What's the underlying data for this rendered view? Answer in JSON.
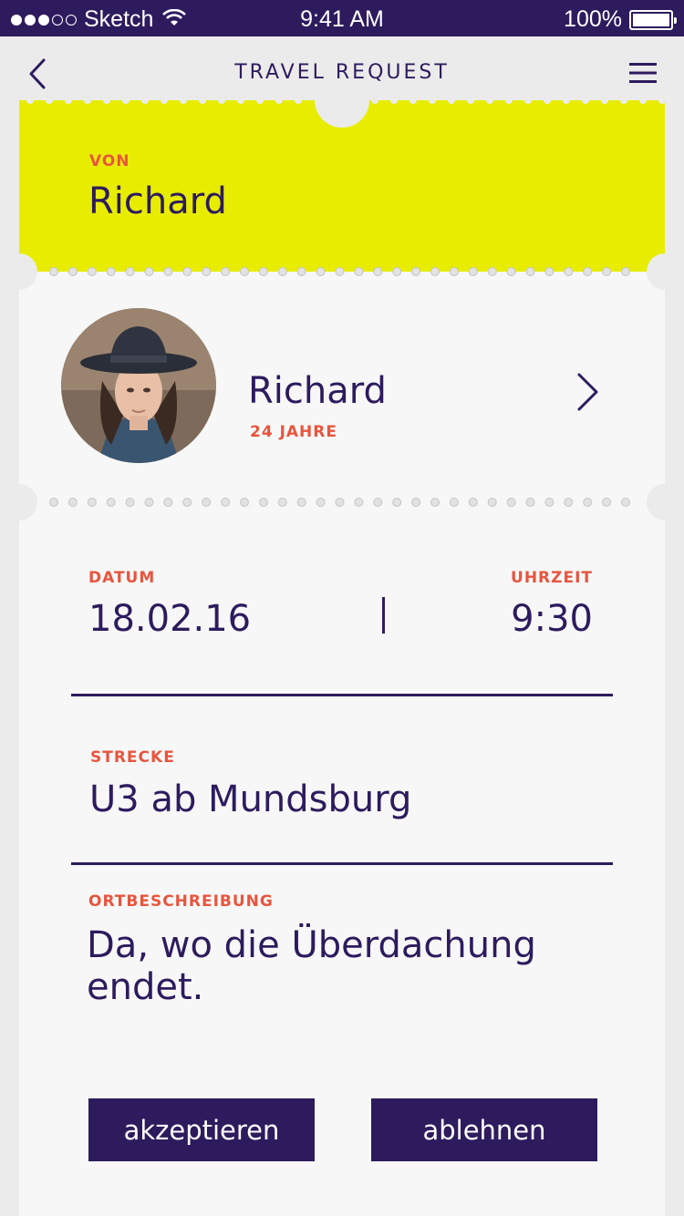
{
  "status_bar": {
    "carrier": "Sketch",
    "time": "9:41 AM",
    "battery": "100%",
    "signal_bars": 3,
    "signal_total": 5,
    "battery_level": 1.0
  },
  "nav": {
    "title": "TRAVEL REQUEST",
    "back_icon": "chevron-left-icon",
    "menu_icon": "hamburger-menu-icon"
  },
  "ticket": {
    "from_label": "VON",
    "from_name": "Richard"
  },
  "profile": {
    "name": "Richard",
    "age": "24 JAHRE",
    "chevron_icon": "chevron-right-icon"
  },
  "details": {
    "date_label": "DATUM",
    "date_value": "18.02.16",
    "time_label": "UHRZEIT",
    "time_value": "9:30",
    "route_label": "STRECKE",
    "route_value": "U3 ab Mundsburg",
    "description_label": "ORTBESCHREIBUNG",
    "description_value": "Da, wo die Überdachung endet."
  },
  "actions": {
    "accept": "akzeptieren",
    "decline": "ablehnen"
  },
  "colors": {
    "primary": "#2d1b5e",
    "accent": "#e8553e",
    "ticket_top": "#e8ed00",
    "ticket_body": "#f7f7f7"
  }
}
